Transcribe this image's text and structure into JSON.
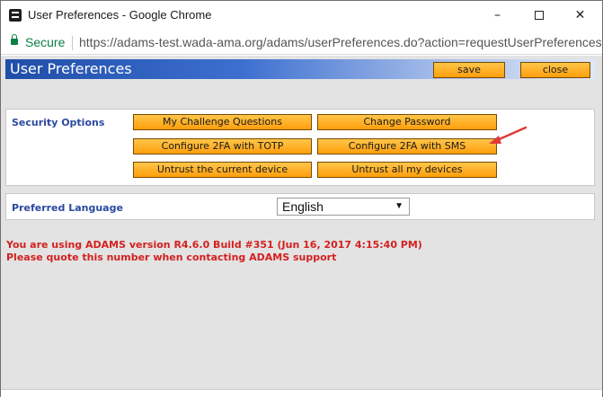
{
  "window": {
    "title": "User Preferences - Google Chrome",
    "minimize": "–",
    "close": "✕"
  },
  "address_bar": {
    "secure_label": "Secure",
    "url": "https://adams-test.wada-ama.org/adams/userPreferences.do?action=requestUserPreferencesF"
  },
  "header": {
    "title": "User Preferences",
    "save_label": "save",
    "close_label": "close"
  },
  "security_options": {
    "label": "Security Options",
    "buttons": [
      "My Challenge Questions",
      "Change Password",
      "Configure 2FA with TOTP",
      "Configure 2FA with SMS",
      "Untrust the current device",
      "Untrust all my devices"
    ]
  },
  "preferred_language": {
    "label": "Preferred Language",
    "selected": "English"
  },
  "version_info": {
    "line1": "You are using ADAMS version R4.6.0 Build #351 (Jun 16, 2017 4:15:40 PM)",
    "line2": "Please quote this number when contacting ADAMS support"
  },
  "colors": {
    "button_orange": "#ff9e0c",
    "header_blue": "#1f4ea8",
    "label_blue": "#2a4aa0",
    "warning_red": "#d42020",
    "secure_green": "#0b8043",
    "arrow_red": "#e03a3a"
  }
}
